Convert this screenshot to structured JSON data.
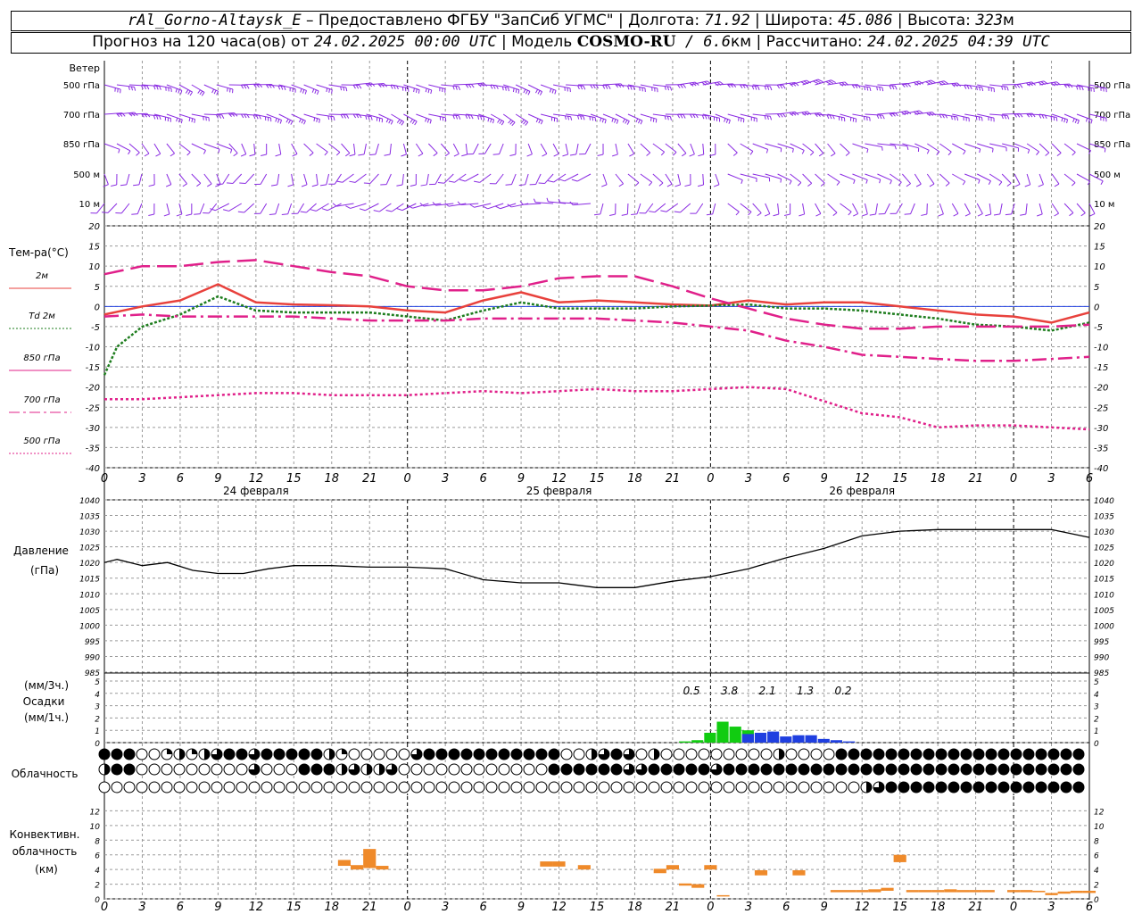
{
  "header": {
    "station": "rAl_Gorno-Altaysk_E",
    "provided_by": " – Предоставлено ФГБУ \"ЗапСиб УГМС\" | Долгота: ",
    "lon": "71.92",
    "lat_label": " | Широта: ",
    "lat": "45.086",
    "alt_label": " | Высота: ",
    "alt": "323",
    "alt_unit": "м",
    "forecast_label": "Прогноз на 120 часа(ов) от ",
    "run_time": "24.02.2025 00:00 UTC",
    "model_label": " | Модель ",
    "model": "COSMO-RU",
    "res_sep": " / ",
    "resolution": "6.6",
    "res_unit": "км",
    "calc_label": " | Рассчитано: ",
    "calc_time": "24.02.2025 04:39 UTC"
  },
  "x_ticks": [
    "0",
    "3",
    "6",
    "9",
    "12",
    "15",
    "18",
    "21",
    "0",
    "3",
    "6",
    "9",
    "12",
    "15",
    "18",
    "21",
    "0",
    "3",
    "6",
    "9",
    "12",
    "15",
    "18",
    "21",
    "0",
    "3",
    "6"
  ],
  "dates": [
    "24 февраля",
    "25 февраля",
    "26 февраля"
  ],
  "panels": {
    "wind": {
      "title": "Ветер",
      "levels": [
        "500 гПа",
        "700 гПа",
        "850 гПа",
        "500 м",
        "10 м"
      ]
    },
    "temp": {
      "title": "Тем-ра(°C)",
      "ylim": [
        -40,
        20
      ],
      "yticks": [
        "20",
        "15",
        "10",
        "5",
        "0",
        "-5",
        "-10",
        "-15",
        "-20",
        "-25",
        "-30",
        "-35",
        "-40"
      ],
      "legend": [
        {
          "label": "2м",
          "color": "#e8413c",
          "dash": "solid"
        },
        {
          "label": "Td  2м",
          "color": "#1e7d1e",
          "dash": "dotted"
        },
        {
          "label": "850 гПа",
          "color": "#e0208a",
          "dash": "solid"
        },
        {
          "label": "700 гПа",
          "color": "#e0208a",
          "dash": "dashdot"
        },
        {
          "label": "500 гПа",
          "color": "#e0208a",
          "dash": "dotted"
        }
      ]
    },
    "pressure": {
      "title": "Давление",
      "unit": "(гПа)",
      "ylim": [
        985,
        1040
      ],
      "yticks": [
        "1040",
        "1035",
        "1030",
        "1025",
        "1020",
        "1015",
        "1010",
        "1005",
        "1000",
        "995",
        "990",
        "985"
      ]
    },
    "precip": {
      "title1": "(мм/3ч.)",
      "title2": "Осадки",
      "title3": "(мм/1ч.)",
      "ylim": [
        0,
        5
      ],
      "yticks": [
        "5",
        "4",
        "3",
        "2",
        "1",
        "0"
      ],
      "totals": [
        "0.5",
        "3.8",
        "2.1",
        "1.3",
        "0.2"
      ]
    },
    "cloud": {
      "title": "Облачность"
    },
    "conv": {
      "title1": "Конвективн.",
      "title2": "облачность",
      "title3": "(км)",
      "ylim": [
        0,
        14
      ],
      "yticks": [
        "12",
        "10",
        "8",
        "6",
        "4",
        "2",
        "0"
      ]
    }
  },
  "colors": {
    "wind": "#8a2be2",
    "grid": "#9a9a9a",
    "rain": "#11cc11",
    "snow": "#1f3fe0",
    "conv": "#ef8a2a"
  },
  "chart_data": [
    {
      "type": "line",
      "name_ref": "temp",
      "x_unit": "hours from 24.02.2025 00:00 UTC",
      "series": [
        {
          "name": "2м",
          "x": [
            0,
            3,
            6,
            9,
            12,
            15,
            18,
            21,
            24,
            27,
            30,
            33,
            36,
            39,
            42,
            45,
            48,
            51,
            54,
            57,
            60,
            63,
            66,
            69,
            72,
            75,
            78
          ],
          "values": [
            -2,
            0,
            1.5,
            5.5,
            1,
            0.5,
            0.3,
            0,
            -1,
            -1.5,
            1.5,
            3.5,
            1,
            1.5,
            1,
            0.5,
            0.2,
            1.5,
            0.5,
            1,
            1,
            0,
            -1,
            -2,
            -2.5,
            -4,
            -1.5
          ]
        },
        {
          "name": "Td  2м",
          "x": [
            0,
            1,
            3,
            6,
            9,
            12,
            15,
            18,
            21,
            24,
            27,
            30,
            33,
            36,
            39,
            42,
            45,
            48,
            51,
            54,
            57,
            60,
            63,
            66,
            69,
            72,
            75,
            78
          ],
          "values": [
            -17,
            -10,
            -5,
            -2,
            2.5,
            -1,
            -1.5,
            -1.5,
            -1.5,
            -2.5,
            -3.5,
            -1,
            1,
            -0.5,
            -0.5,
            -0.5,
            0,
            0.2,
            0.5,
            -0.5,
            -0.5,
            -1,
            -2,
            -3,
            -4.5,
            -5,
            -6,
            -4
          ]
        },
        {
          "name": "850 гПа",
          "x": [
            0,
            3,
            6,
            9,
            12,
            15,
            18,
            21,
            24,
            27,
            30,
            33,
            36,
            39,
            42,
            45,
            48,
            51,
            54,
            57,
            60,
            63,
            66,
            69,
            72,
            75,
            78
          ],
          "values": [
            8,
            10,
            10,
            11,
            11.5,
            10,
            8.5,
            7.5,
            5,
            4,
            4,
            5,
            7,
            7.5,
            7.5,
            5,
            2,
            -0.5,
            -3,
            -4.5,
            -5.5,
            -5.5,
            -5,
            -5,
            -5,
            -5,
            -4.5
          ]
        },
        {
          "name": "700 гПа",
          "x": [
            0,
            3,
            6,
            9,
            12,
            15,
            18,
            21,
            24,
            27,
            30,
            33,
            36,
            39,
            42,
            45,
            48,
            51,
            54,
            57,
            60,
            63,
            66,
            69,
            72,
            75,
            78
          ],
          "values": [
            -2.5,
            -2,
            -2.5,
            -2.5,
            -2.5,
            -2.5,
            -3,
            -3.5,
            -3.5,
            -3.5,
            -3,
            -3,
            -3,
            -3,
            -3.5,
            -4,
            -5,
            -6,
            -8.5,
            -10,
            -12,
            -12.5,
            -13,
            -13.5,
            -13.5,
            -13,
            -12.5
          ]
        },
        {
          "name": "500 гПа",
          "x": [
            0,
            3,
            6,
            9,
            12,
            15,
            18,
            21,
            24,
            27,
            30,
            33,
            36,
            39,
            42,
            45,
            48,
            51,
            54,
            57,
            60,
            63,
            66,
            69,
            72,
            75,
            78
          ],
          "values": [
            -23,
            -23,
            -22.5,
            -22,
            -21.5,
            -21.5,
            -22,
            -22,
            -22,
            -21.5,
            -21,
            -21.5,
            -21,
            -20.5,
            -21,
            -21,
            -20.5,
            -20,
            -20.5,
            -23.5,
            -26.5,
            -27.5,
            -30,
            -29.5,
            -29.5,
            -30,
            -30.5
          ]
        }
      ]
    },
    {
      "type": "line",
      "name_ref": "pressure",
      "series": [
        {
          "name": "Давление",
          "x": [
            0,
            1,
            3,
            5,
            7,
            9,
            11,
            13,
            15,
            18,
            21,
            24,
            27,
            30,
            33,
            36,
            39,
            42,
            45,
            48,
            51,
            54,
            57,
            60,
            63,
            66,
            69,
            72,
            75,
            78
          ],
          "values": [
            1020,
            1021,
            1019,
            1020,
            1017.5,
            1016.5,
            1016.5,
            1018,
            1019,
            1019,
            1018.5,
            1018.5,
            1018,
            1014.5,
            1013.5,
            1013.5,
            1012,
            1012,
            1014,
            1015.5,
            1018,
            1021.5,
            1024.5,
            1028.5,
            1030,
            1030.5,
            1030.5,
            1030.5,
            1030.5,
            1028
          ]
        }
      ]
    },
    {
      "type": "bar",
      "name_ref": "precip",
      "series": [
        {
          "name": "rain",
          "x": [
            46,
            47,
            48,
            49,
            50,
            51
          ],
          "values": [
            0.1,
            0.2,
            0.8,
            1.7,
            1.3,
            1.0
          ]
        },
        {
          "name": "snow",
          "x": [
            51,
            52,
            53,
            54,
            55,
            56,
            57,
            58,
            59
          ],
          "values": [
            0.7,
            0.8,
            0.9,
            0.5,
            0.6,
            0.6,
            0.3,
            0.2,
            0.1
          ]
        }
      ]
    },
    {
      "type": "bar",
      "name_ref": "conv",
      "series": [
        {
          "name": "conv",
          "x": [
            19,
            20,
            21,
            22,
            35,
            36,
            38,
            44,
            45,
            46,
            47,
            48,
            49,
            52,
            55,
            58,
            59,
            60,
            61,
            62,
            63,
            64,
            65,
            66,
            67,
            68,
            69,
            70,
            72,
            73,
            74,
            75,
            76,
            77,
            78
          ],
          "values": [
            [
              4.5,
              5.3
            ],
            [
              4,
              4.6
            ],
            [
              4.2,
              6.8
            ],
            [
              4,
              4.5
            ],
            [
              4.4,
              5.1
            ],
            [
              4.4,
              5.1
            ],
            [
              4,
              4.6
            ],
            [
              3.5,
              4.1
            ],
            [
              4,
              4.6
            ],
            [
              1.8,
              2.1
            ],
            [
              1.5,
              2
            ],
            [
              4,
              4.6
            ],
            [
              0.4,
              0.5
            ],
            [
              3.2,
              3.9
            ],
            [
              3.2,
              3.9
            ],
            [
              0.9,
              1.2
            ],
            [
              0.9,
              1.2
            ],
            [
              0.9,
              1.2
            ],
            [
              0.9,
              1.3
            ],
            [
              1.1,
              1.5
            ],
            [
              5,
              6
            ],
            [
              0.9,
              1.2
            ],
            [
              0.9,
              1.2
            ],
            [
              0.9,
              1.2
            ],
            [
              0.9,
              1.3
            ],
            [
              0.9,
              1.2
            ],
            [
              0.9,
              1.2
            ],
            [
              0.9,
              1.2
            ],
            [
              0.9,
              1.2
            ],
            [
              0.9,
              1.2
            ],
            [
              0.9,
              1.1
            ],
            [
              0.5,
              0.8
            ],
            [
              0.7,
              1
            ],
            [
              0.8,
              1.1
            ],
            [
              0.8,
              1.1
            ]
          ]
        }
      ]
    }
  ]
}
